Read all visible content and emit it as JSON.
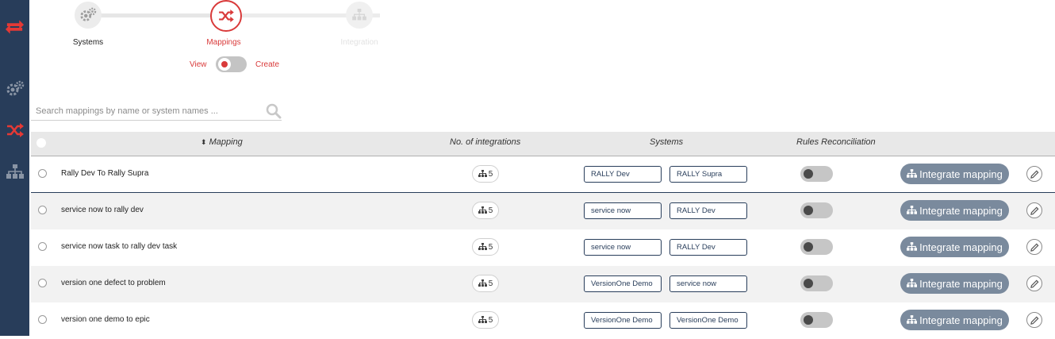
{
  "stepper": {
    "steps": [
      {
        "label": "Systems",
        "icon": "gears-icon",
        "state": "done"
      },
      {
        "label": "Mappings",
        "icon": "shuffle-icon",
        "state": "active"
      },
      {
        "label": "Integration",
        "icon": "sitemap-icon",
        "state": "disabled"
      }
    ]
  },
  "mode_toggle": {
    "left_label": "View",
    "right_label": "Create"
  },
  "search": {
    "placeholder": "Search mappings by name or system names ..."
  },
  "table": {
    "headers": {
      "mapping": "Mapping",
      "integrations": "No. of integrations",
      "systems": "Systems",
      "rules": "Rules Reconciliation"
    },
    "integrate_label": "Integrate mapping",
    "rows": [
      {
        "name": "Rally Dev To Rally Supra",
        "count": "5",
        "sys1": "RALLY Dev",
        "sys2": "RALLY Supra"
      },
      {
        "name": "service now to rally dev",
        "count": "5",
        "sys1": "service now",
        "sys2": "RALLY Dev"
      },
      {
        "name": "service now task to rally dev task",
        "count": "5",
        "sys1": "service now",
        "sys2": "RALLY Dev"
      },
      {
        "name": "version one defect to problem",
        "count": "5",
        "sys1": "VersionOne Demo",
        "sys2": "service now"
      },
      {
        "name": "version one demo to epic",
        "count": "5",
        "sys1": "VersionOne Demo",
        "sys2": "VersionOne Demo"
      }
    ]
  },
  "colors": {
    "sidebar": "#283d5a",
    "accent": "#d93a3a",
    "button": "#7a8a9d"
  }
}
